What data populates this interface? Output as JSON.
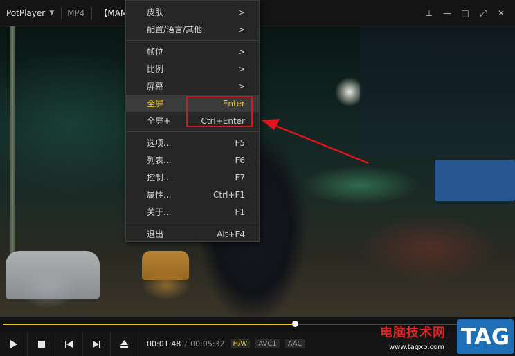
{
  "titlebar": {
    "app_name": "PotPlayer",
    "format": "MP4",
    "file_title": "【MAM"
  },
  "menu": {
    "items": [
      {
        "label": "皮肤",
        "accel": ">"
      },
      {
        "label": "配置/语言/其他",
        "accel": ">"
      },
      {
        "label": "帧位",
        "accel": ">"
      },
      {
        "label": "比例",
        "accel": ">"
      },
      {
        "label": "屏幕",
        "accel": ">"
      },
      {
        "label": "全屏",
        "accel": "Enter"
      },
      {
        "label": "全屏+",
        "accel": "Ctrl+Enter"
      },
      {
        "label": "选项...",
        "accel": "F5"
      },
      {
        "label": "列表...",
        "accel": "F6"
      },
      {
        "label": "控制...",
        "accel": "F7"
      },
      {
        "label": "属性...",
        "accel": "Ctrl+F1"
      },
      {
        "label": "关于...",
        "accel": "F1"
      },
      {
        "label": "退出",
        "accel": "Alt+F4"
      }
    ]
  },
  "playback": {
    "current_time": "00:01:48",
    "total_time": "00:05:32",
    "progress_fraction": 0.573,
    "badges": [
      "H/W",
      "AVC1",
      "AAC"
    ]
  },
  "watermark": {
    "site_name": "电脑技术网",
    "url": "www.tagxp.com",
    "tag": "TAG"
  },
  "colors": {
    "accent": "#f5c518",
    "annotation": "#e3131b"
  }
}
